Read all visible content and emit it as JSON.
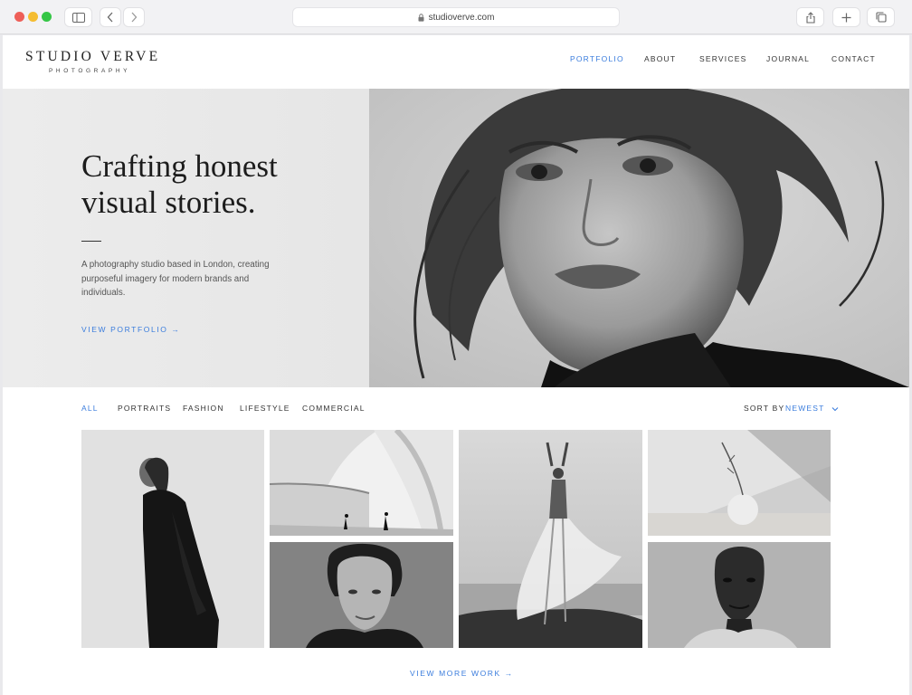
{
  "browser": {
    "url": "studioverve.com"
  },
  "brand": {
    "name": "STUDIO VERVE",
    "tagline": "PHOTOGRAPHY",
    "accent_color": "#3b7ddd"
  },
  "nav": {
    "items": [
      {
        "label": "PORTFOLIO",
        "active": true
      },
      {
        "label": "ABOUT",
        "active": false
      },
      {
        "label": "SERVICES",
        "active": false
      },
      {
        "label": "JOURNAL",
        "active": false
      },
      {
        "label": "CONTACT",
        "active": false
      }
    ]
  },
  "hero": {
    "title_line1": "Crafting honest",
    "title_line2": "visual stories.",
    "description": "A photography studio based in London, creating purposeful imagery for modern brands and individuals.",
    "cta": "VIEW PORTFOLIO →",
    "image": "black-and-white close-up portrait of a woman with freckles"
  },
  "filters": {
    "items": [
      {
        "label": "ALL",
        "active": true
      },
      {
        "label": "PORTRAITS",
        "active": false
      },
      {
        "label": "FASHION",
        "active": false
      },
      {
        "label": "LIFESTYLE",
        "active": false
      },
      {
        "label": "COMMERCIAL",
        "active": false
      }
    ],
    "sort_label": "SORT BY",
    "sort_value": "NEWEST"
  },
  "gallery": {
    "images": [
      "woman in long black coat",
      "curved white architecture with two figures",
      "dancer in flowing white dress on rocks",
      "dried branch in small round vase",
      "man with curly hair portrait",
      "man portrait in light jacket"
    ]
  },
  "footer": {
    "more_label": "VIEW MORE WORK →"
  }
}
